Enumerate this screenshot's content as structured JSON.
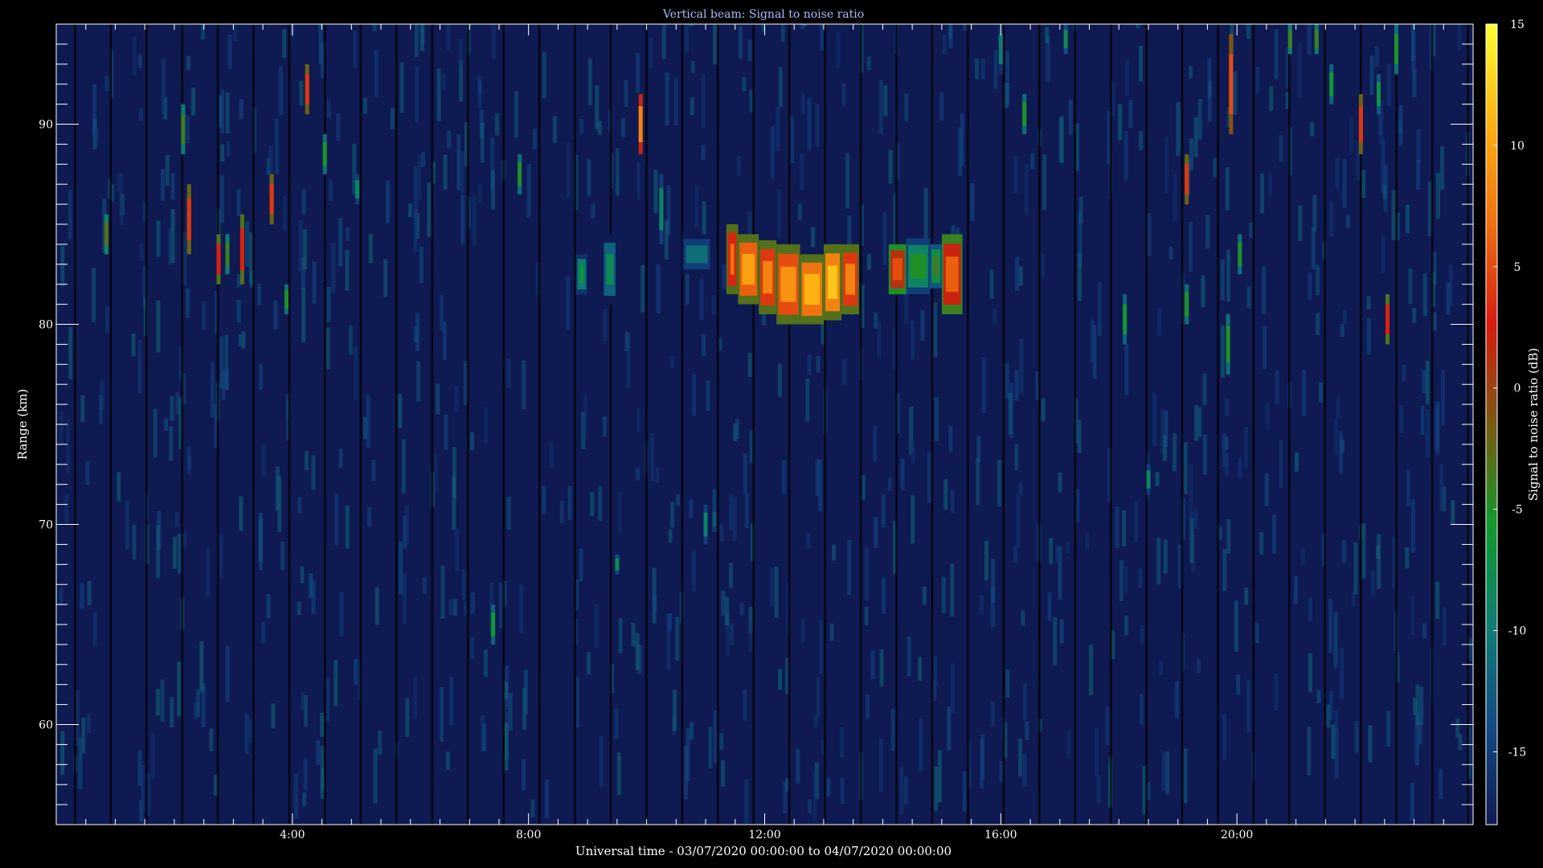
{
  "chart_data": {
    "type": "heatmap",
    "title": "Vertical beam: Signal to noise ratio",
    "xlabel": "Universal time - 03/07/2020 00:00:00 to 04/07/2020 00:00:00",
    "ylabel": "Range (km)",
    "colorbar_label": "Signal to noise ratio (dB)",
    "x_unit": "hours UT",
    "xlim": [
      0,
      24
    ],
    "ylim": [
      55,
      95
    ],
    "x_ticks": [
      {
        "value": 4,
        "label": "4:00"
      },
      {
        "value": 8,
        "label": "8:00"
      },
      {
        "value": 12,
        "label": "12:00"
      },
      {
        "value": 16,
        "label": "16:00"
      },
      {
        "value": 20,
        "label": "20:00"
      }
    ],
    "y_ticks": [
      {
        "value": 60,
        "label": "60"
      },
      {
        "value": 70,
        "label": "70"
      },
      {
        "value": 80,
        "label": "80"
      },
      {
        "value": 90,
        "label": "90"
      }
    ],
    "colorbar_range": [
      -18,
      15
    ],
    "colorbar_ticks": [
      {
        "value": 15,
        "label": "15"
      },
      {
        "value": 10,
        "label": "10"
      },
      {
        "value": 5,
        "label": "5"
      },
      {
        "value": 0,
        "label": "0"
      },
      {
        "value": -5,
        "label": "-5"
      },
      {
        "value": -10,
        "label": "-10"
      },
      {
        "value": -15,
        "label": "-15"
      }
    ],
    "background_db": -16,
    "colormap": [
      "#0f1a52",
      "#124a86",
      "#0e7d72",
      "#0f9a2c",
      "#7a5a10",
      "#d81a10",
      "#ee7010",
      "#ffb010",
      "#ffff30"
    ],
    "echo_layer": [
      {
        "x": [
          11.35,
          11.55
        ],
        "y": [
          81.5,
          85.0
        ],
        "db": 7
      },
      {
        "x": [
          11.55,
          11.9
        ],
        "y": [
          81.0,
          84.5
        ],
        "db": 10
      },
      {
        "x": [
          11.9,
          12.2
        ],
        "y": [
          80.5,
          84.2
        ],
        "db": 8
      },
      {
        "x": [
          12.2,
          12.6
        ],
        "y": [
          80.0,
          84.0
        ],
        "db": 9
      },
      {
        "x": [
          12.6,
          13.0
        ],
        "y": [
          80.0,
          83.5
        ],
        "db": 11
      },
      {
        "x": [
          13.0,
          13.3
        ],
        "y": [
          80.2,
          84.0
        ],
        "db": 12
      },
      {
        "x": [
          13.3,
          13.6
        ],
        "y": [
          80.5,
          84.0
        ],
        "db": 8
      },
      {
        "x": [
          14.1,
          14.4
        ],
        "y": [
          81.5,
          84.0
        ],
        "db": 5
      },
      {
        "x": [
          14.4,
          14.8
        ],
        "y": [
          81.5,
          84.3
        ],
        "db": -5
      },
      {
        "x": [
          14.8,
          15.0
        ],
        "y": [
          81.8,
          84.0
        ],
        "db": -3
      },
      {
        "x": [
          15.0,
          15.35
        ],
        "y": [
          80.5,
          84.5
        ],
        "db": 6
      },
      {
        "x": [
          8.8,
          9.0
        ],
        "y": [
          81.5,
          83.5
        ],
        "db": -6
      },
      {
        "x": [
          9.25,
          9.5
        ],
        "y": [
          81.0,
          84.5
        ],
        "db": -8
      },
      {
        "x": [
          10.6,
          11.1
        ],
        "y": [
          82.5,
          84.5
        ],
        "db": -11
      }
    ],
    "streaks": [
      {
        "x": 0.85,
        "y": [
          83.5,
          85.5
        ],
        "db": -3
      },
      {
        "x": 2.15,
        "y": [
          88.5,
          91.0
        ],
        "db": -4
      },
      {
        "x": 2.25,
        "y": [
          83.5,
          87.0
        ],
        "db": 4
      },
      {
        "x": 2.75,
        "y": [
          82.0,
          84.5
        ],
        "db": 3
      },
      {
        "x": 2.9,
        "y": [
          82.5,
          84.5
        ],
        "db": -4
      },
      {
        "x": 3.15,
        "y": [
          82.0,
          85.5
        ],
        "db": 3
      },
      {
        "x": 3.65,
        "y": [
          85.0,
          87.5
        ],
        "db": 4
      },
      {
        "x": 3.9,
        "y": [
          80.5,
          82.0
        ],
        "db": -5
      },
      {
        "x": 4.25,
        "y": [
          90.5,
          93.0
        ],
        "db": 4
      },
      {
        "x": 4.55,
        "y": [
          87.5,
          89.5
        ],
        "db": -5
      },
      {
        "x": 5.1,
        "y": [
          86.0,
          87.5
        ],
        "db": -9
      },
      {
        "x": 7.85,
        "y": [
          86.5,
          88.5
        ],
        "db": -5
      },
      {
        "x": 7.4,
        "y": [
          64.0,
          66.0
        ],
        "db": -6
      },
      {
        "x": 9.9,
        "y": [
          88.5,
          91.5
        ],
        "db": 8
      },
      {
        "x": 10.25,
        "y": [
          84.0,
          87.5
        ],
        "db": -9
      },
      {
        "x": 11.0,
        "y": [
          69.0,
          71.0
        ],
        "db": -9
      },
      {
        "x": 9.5,
        "y": [
          67.5,
          68.5
        ],
        "db": -8
      },
      {
        "x": 16.4,
        "y": [
          89.5,
          91.5
        ],
        "db": -5
      },
      {
        "x": 19.15,
        "y": [
          86.0,
          88.5
        ],
        "db": 4
      },
      {
        "x": 19.15,
        "y": [
          80.0,
          82.0
        ],
        "db": -5
      },
      {
        "x": 19.9,
        "y": [
          89.5,
          94.5
        ],
        "db": 5
      },
      {
        "x": 19.85,
        "y": [
          77.5,
          80.5
        ],
        "db": -5
      },
      {
        "x": 20.05,
        "y": [
          82.5,
          84.5
        ],
        "db": -5
      },
      {
        "x": 20.9,
        "y": [
          93.5,
          95.0
        ],
        "db": -4
      },
      {
        "x": 21.35,
        "y": [
          93.5,
          95.0
        ],
        "db": -4
      },
      {
        "x": 21.6,
        "y": [
          91.0,
          93.0
        ],
        "db": -6
      },
      {
        "x": 22.1,
        "y": [
          88.5,
          91.5
        ],
        "db": 4
      },
      {
        "x": 22.4,
        "y": [
          90.5,
          92.5
        ],
        "db": -7
      },
      {
        "x": 22.55,
        "y": [
          79.0,
          81.5
        ],
        "db": 3
      },
      {
        "x": 22.7,
        "y": [
          92.5,
          95.0
        ],
        "db": -5
      },
      {
        "x": 18.1,
        "y": [
          79.0,
          81.5
        ],
        "db": -6
      },
      {
        "x": 18.5,
        "y": [
          71.5,
          73.0
        ],
        "db": -9
      },
      {
        "x": 16.0,
        "y": [
          92.5,
          95.0
        ],
        "db": -10
      },
      {
        "x": 17.1,
        "y": [
          93.5,
          95.0
        ],
        "db": -8
      }
    ]
  }
}
